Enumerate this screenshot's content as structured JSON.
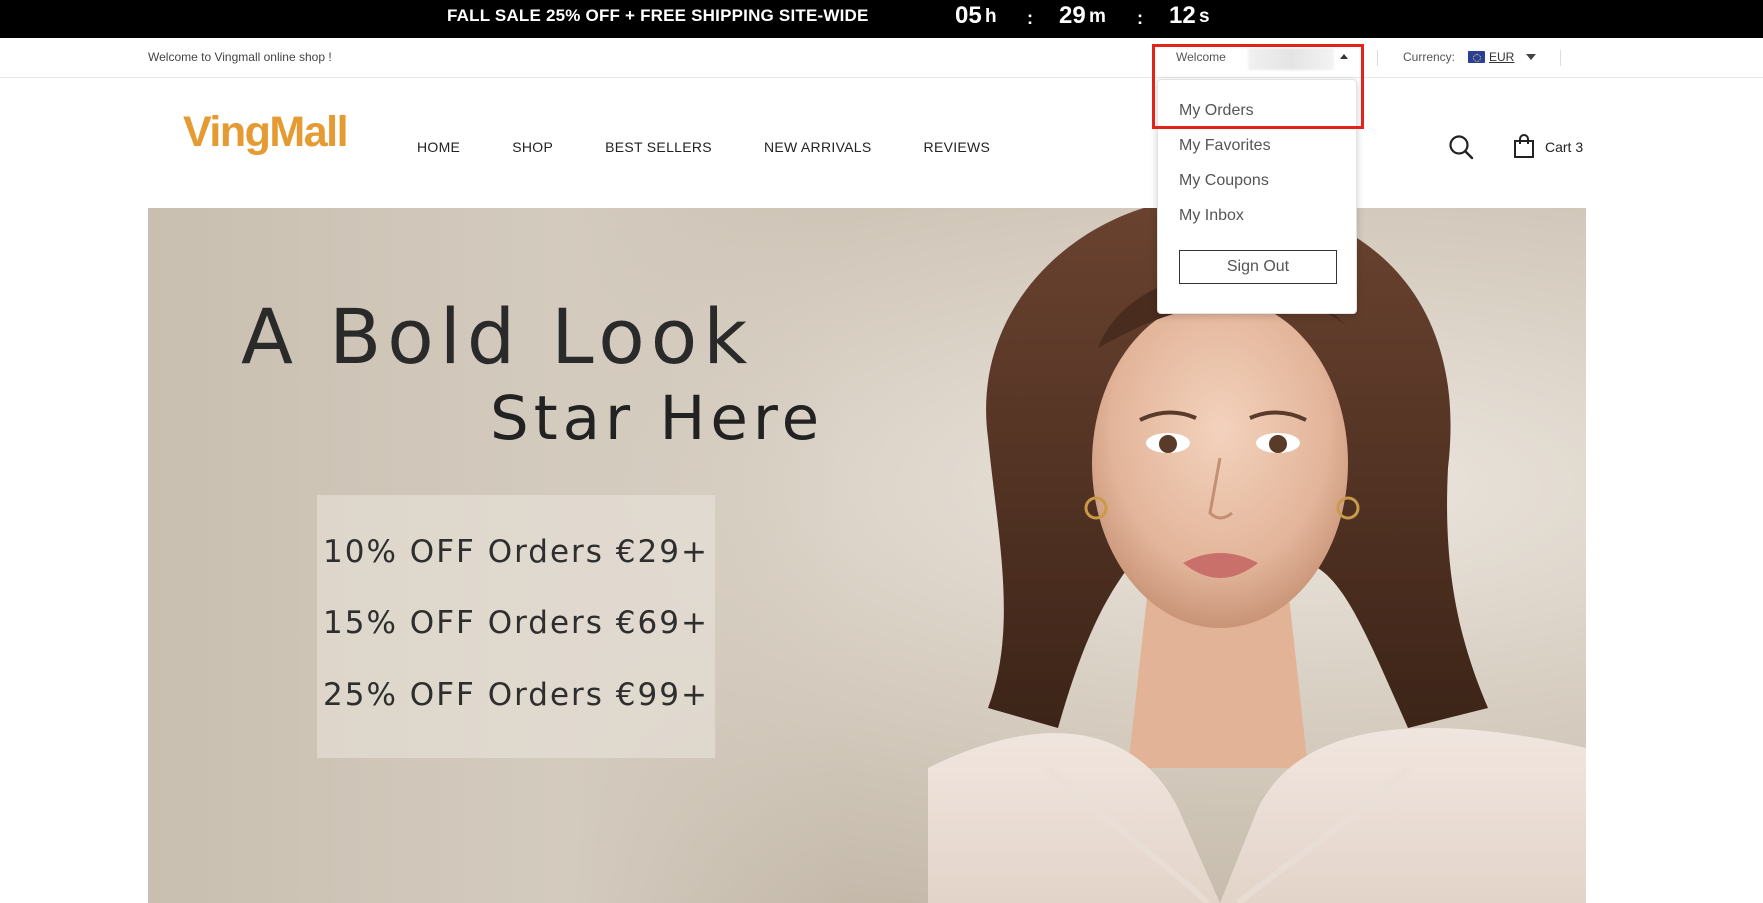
{
  "promo": {
    "text": "FALL SALE 25% OFF + FREE SHIPPING SITE-WIDE",
    "countdown": {
      "hours": "05",
      "hours_unit": "h",
      "minutes": "29",
      "minutes_unit": "m",
      "seconds": "12",
      "seconds_unit": "s",
      "separator": ":"
    }
  },
  "topbar": {
    "welcome_text": "Welcome to Vingmall online shop !",
    "account_label": "Welcome",
    "currency_label": "Currency:",
    "currency_code": "EUR"
  },
  "header": {
    "logo": "VingMall",
    "nav": [
      "HOME",
      "SHOP",
      "BEST SELLERS",
      "NEW ARRIVALS",
      "REVIEWS"
    ],
    "cart_label": "Cart 3"
  },
  "account_menu": {
    "items": [
      "My Orders",
      "My Favorites",
      "My Coupons",
      "My Inbox"
    ],
    "sign_out": "Sign Out"
  },
  "hero": {
    "title_line1": "A Bold Look",
    "title_line2": "Star Here",
    "offers": [
      "10% OFF Orders €29+",
      "15% OFF Orders €69+",
      "25% OFF Orders €99+"
    ]
  },
  "colors": {
    "brand": "#e59a32",
    "promo_bg": "#000000",
    "highlight": "#e2231a"
  }
}
